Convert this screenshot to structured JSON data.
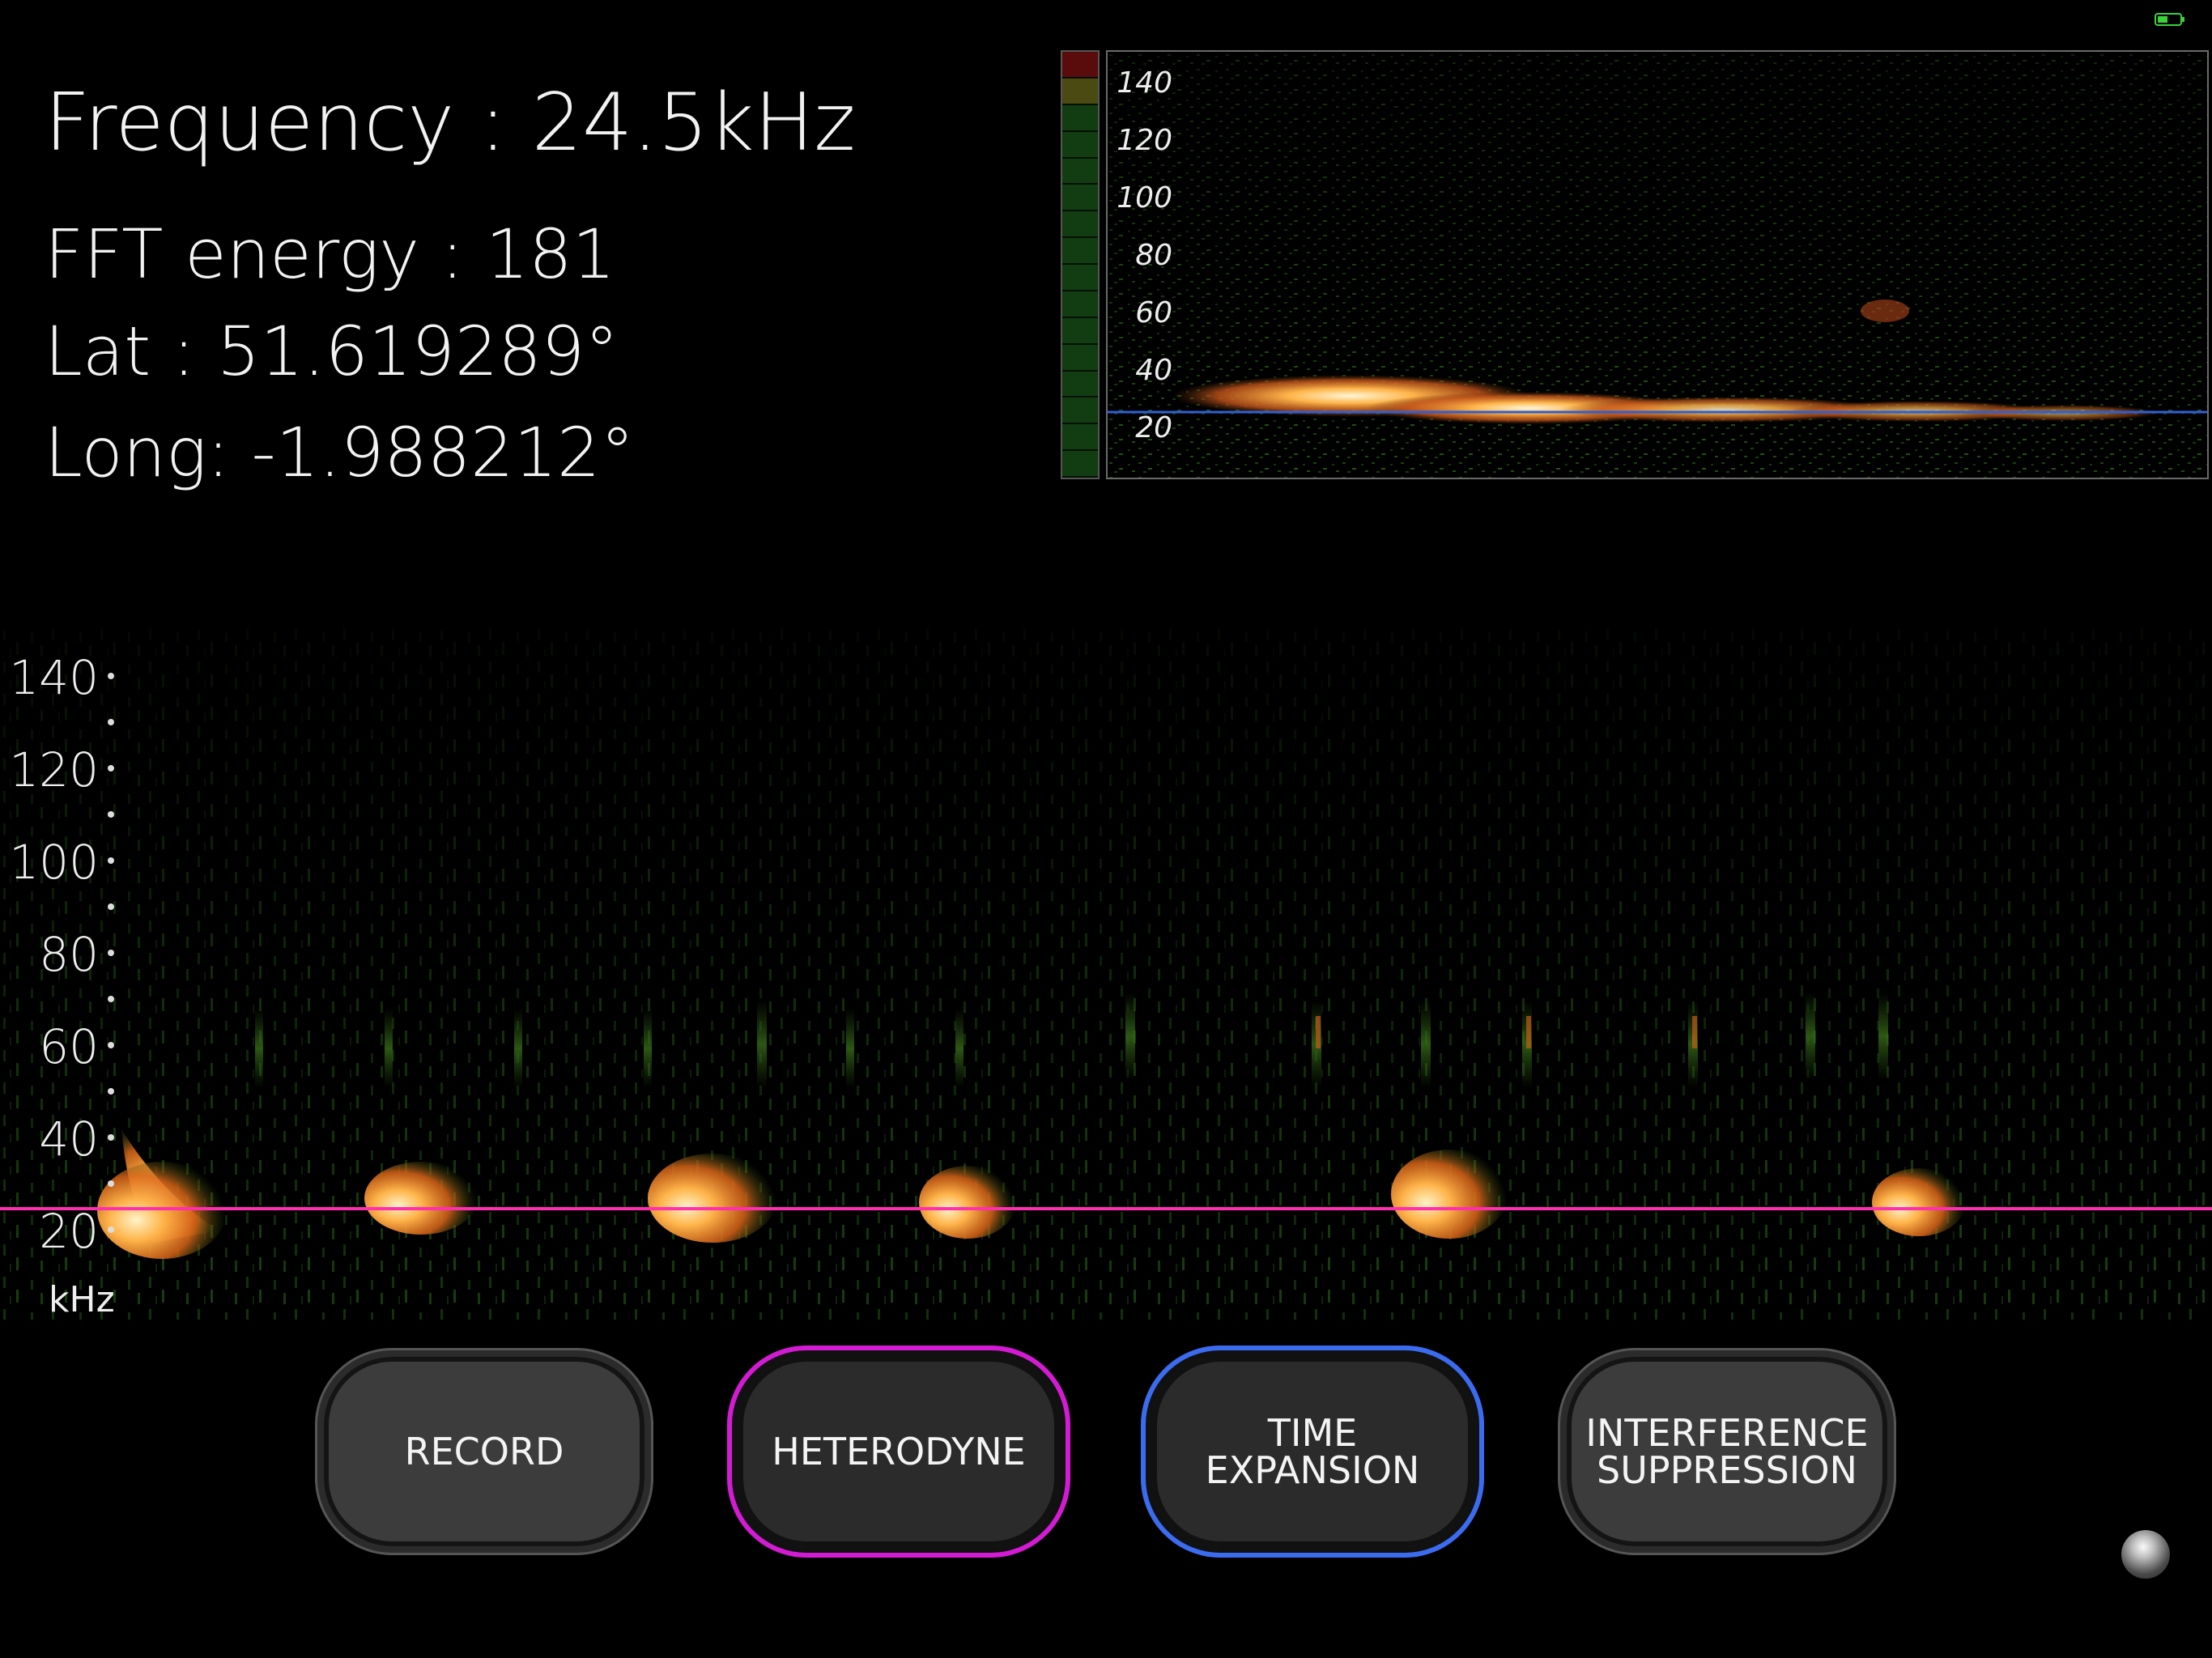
{
  "readouts": {
    "frequency": "Frequency : 24.5kHz",
    "fft_energy": "FFT energy : 181",
    "lat": "Lat : 51.619289°",
    "long": "Long: -1.988212°"
  },
  "mini_spectrogram": {
    "ticks": [
      "140",
      "120",
      "100",
      "80",
      "60",
      "40",
      "20"
    ],
    "marker_khz": 20
  },
  "main_spectrogram": {
    "ticks": [
      "140",
      "120",
      "100",
      "80",
      "60",
      "40",
      "20"
    ],
    "unit": "kHz",
    "marker_khz": 24.5,
    "marker_color": "#ff2fb0"
  },
  "buttons": {
    "record": "RECORD",
    "heterodyne": "HETERODYNE",
    "time_expansion": "TIME\nEXPANSION",
    "interference": "INTERFERENCE\nSUPPRESSION"
  },
  "colors": {
    "heterodyne_accent": "#d21bd2",
    "time_expansion_accent": "#3b6cf0",
    "call_color": "#ffb24a",
    "noise_color": "#2f6b1a"
  },
  "icons": {
    "battery": "battery-icon",
    "orb": "light-orb-icon"
  }
}
